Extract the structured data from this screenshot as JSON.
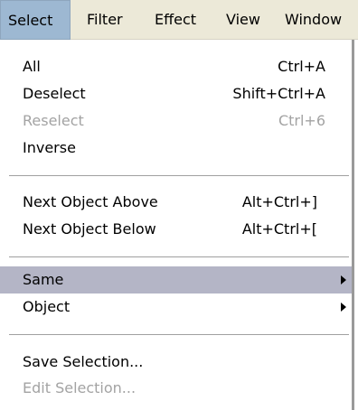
{
  "menubar": {
    "items": [
      "Select",
      "Filter",
      "Effect",
      "View",
      "Window"
    ],
    "active": "Select"
  },
  "menu": {
    "groups": [
      [
        {
          "label": "All",
          "shortcut": "Ctrl+A",
          "enabled": true
        },
        {
          "label": "Deselect",
          "shortcut": "Shift+Ctrl+A",
          "enabled": true
        },
        {
          "label": "Reselect",
          "shortcut": "Ctrl+6",
          "enabled": false
        },
        {
          "label": "Inverse",
          "shortcut": "",
          "enabled": true
        }
      ],
      [
        {
          "label": "Next Object Above",
          "shortcut": "Alt+Ctrl+]",
          "enabled": true
        },
        {
          "label": "Next Object Below",
          "shortcut": "Alt+Ctrl+[",
          "enabled": true
        }
      ],
      [
        {
          "label": "Same",
          "shortcut": "",
          "enabled": true,
          "submenu": true,
          "highlighted": true
        },
        {
          "label": "Object",
          "shortcut": "",
          "enabled": true,
          "submenu": true
        }
      ],
      [
        {
          "label": "Save Selection...",
          "shortcut": "",
          "enabled": true
        },
        {
          "label": "Edit Selection...",
          "shortcut": "",
          "enabled": false
        }
      ]
    ]
  },
  "colors": {
    "menubar_bg": "#ece9d8",
    "active_menubar_bg": "#9db8d2",
    "highlight_bg": "#b4b5c6",
    "disabled_text": "#a3a3a3"
  }
}
